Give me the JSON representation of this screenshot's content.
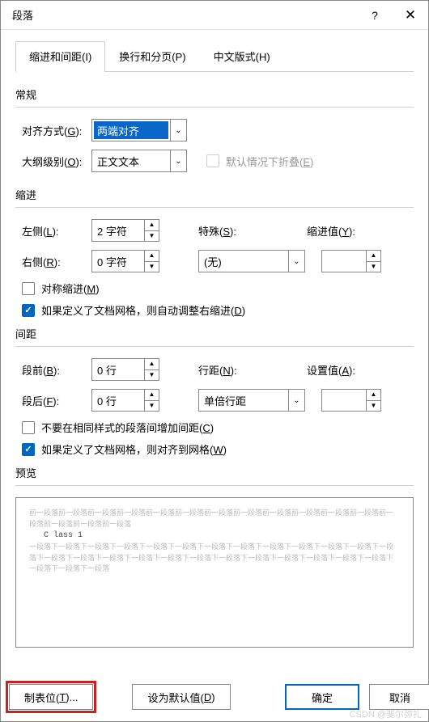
{
  "title": "段落",
  "tabs": {
    "t1": "缩进和间距(I)",
    "t2": "换行和分页(P)",
    "t3": "中文版式(H)"
  },
  "general": {
    "section": "常规",
    "align_label": "对齐方式(G):",
    "align_value": "两端对齐",
    "outline_label": "大纲级别(O):",
    "outline_value": "正文文本",
    "collapse_label": "默认情况下折叠(E)"
  },
  "indent": {
    "section": "缩进",
    "left_label": "左侧(L):",
    "left_value": "2 字符",
    "right_label": "右侧(R):",
    "right_value": "0 字符",
    "special_label": "特殊(S):",
    "special_value": "(无)",
    "by_label": "缩进值(Y):",
    "by_value": "",
    "mirror_label": "对称缩进(M)",
    "grid_label": "如果定义了文档网格，则自动调整右缩进(D)"
  },
  "spacing": {
    "section": "间距",
    "before_label": "段前(B):",
    "before_value": "0 行",
    "after_label": "段后(F):",
    "after_value": "0 行",
    "line_label": "行距(N):",
    "line_value": "单倍行距",
    "at_label": "设置值(A):",
    "at_value": "",
    "nosame_label": "不要在相同样式的段落间增加间距(C)",
    "grid_label": "如果定义了文档网格，则对齐到网格(W)"
  },
  "preview": {
    "section": "预览",
    "prev_text": "前一段落前一段落前一段落前一段落前一段落前一段落前一段落前一段落前一段落前一段落前一段落前一段落前一段落前一段落前一段落前一段落",
    "sample": "C lass 1",
    "next_text": "一段落下一段落下一段落下一段落下一段落下一段落下一段落下一段落下一段落下一段落下一段落下一段落下一段落下一段落下一段落下一段落下一段落下一段落下一段落下一段落下一段落下一段落下一段落下一段落下一段落下一段落下一段落下一段落"
  },
  "footer": {
    "tabs": "制表位(T)...",
    "default": "设为默认值(D)",
    "ok": "确定",
    "cancel": "取消"
  },
  "watermark": "CSDN @斐尔弥扎"
}
